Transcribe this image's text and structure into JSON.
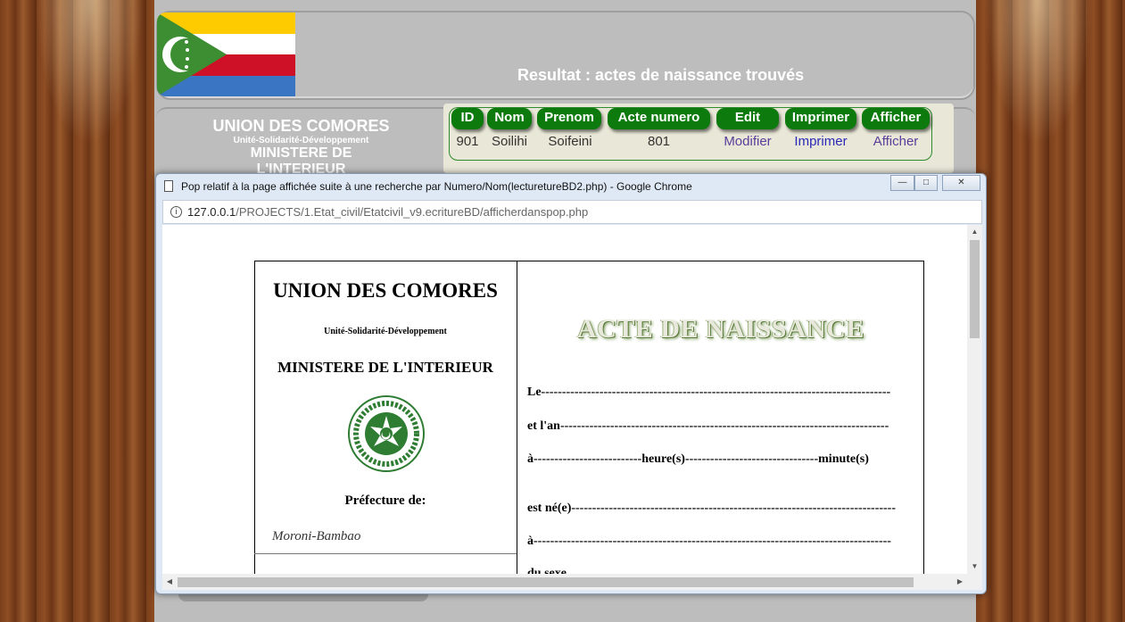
{
  "page": {
    "header_title": "Resultat : actes de naissance trouvés",
    "left_title": {
      "line1": "UNION DES COMORES",
      "line2": "Unité-Solidarité-Développement",
      "line3": "MINISTERE DE L'INTERIEUR"
    },
    "flag_colors": [
      "#fecb00",
      "#ffffff",
      "#ce1126",
      "#3a75c4",
      "#3d8e33"
    ]
  },
  "results_table": {
    "headers": [
      "ID",
      "Nom",
      "Prenom",
      "Acte numero",
      "Edit",
      "Imprimer",
      "Afficher"
    ],
    "rows": [
      {
        "id": "901",
        "nom": "Soilihi",
        "prenom": "Soifeini",
        "acte_numero": "801",
        "edit": "Modifier",
        "imprimer": "Imprimer",
        "afficher": "Afficher"
      }
    ],
    "header_color": "#0d7a0d"
  },
  "popup": {
    "window_title": "Pop relatif à la page affichée suite à une recherche par Numero/Nom(lecturetureBD2.php) - Google Chrome",
    "url_host": "127.0.0.1",
    "url_path": "/PROJECTS/1.Etat_civil/Etatcivil_v9.ecritureBD/afficherdanspop.php",
    "document": {
      "union": "UNION DES COMORES",
      "devise": "Unité-Solidarité-Développement",
      "ministere": "MINISTERE DE L'INTERIEUR",
      "prefecture_label": "Préfecture de:",
      "prefecture_value": "Moroni-Bambao",
      "acte_title": "ACTE DE NAISSANCE",
      "lines": [
        "Le------------------------------------------------------------------------------------",
        "et l'an-------------------------------------------------------------------------------",
        "à--------------------------heure(s)--------------------------------minute(s)",
        "est né(e)------------------------------------------------------------------------------",
        "à--------------------------------------------------------------------------------------",
        "du sexe"
      ]
    }
  }
}
